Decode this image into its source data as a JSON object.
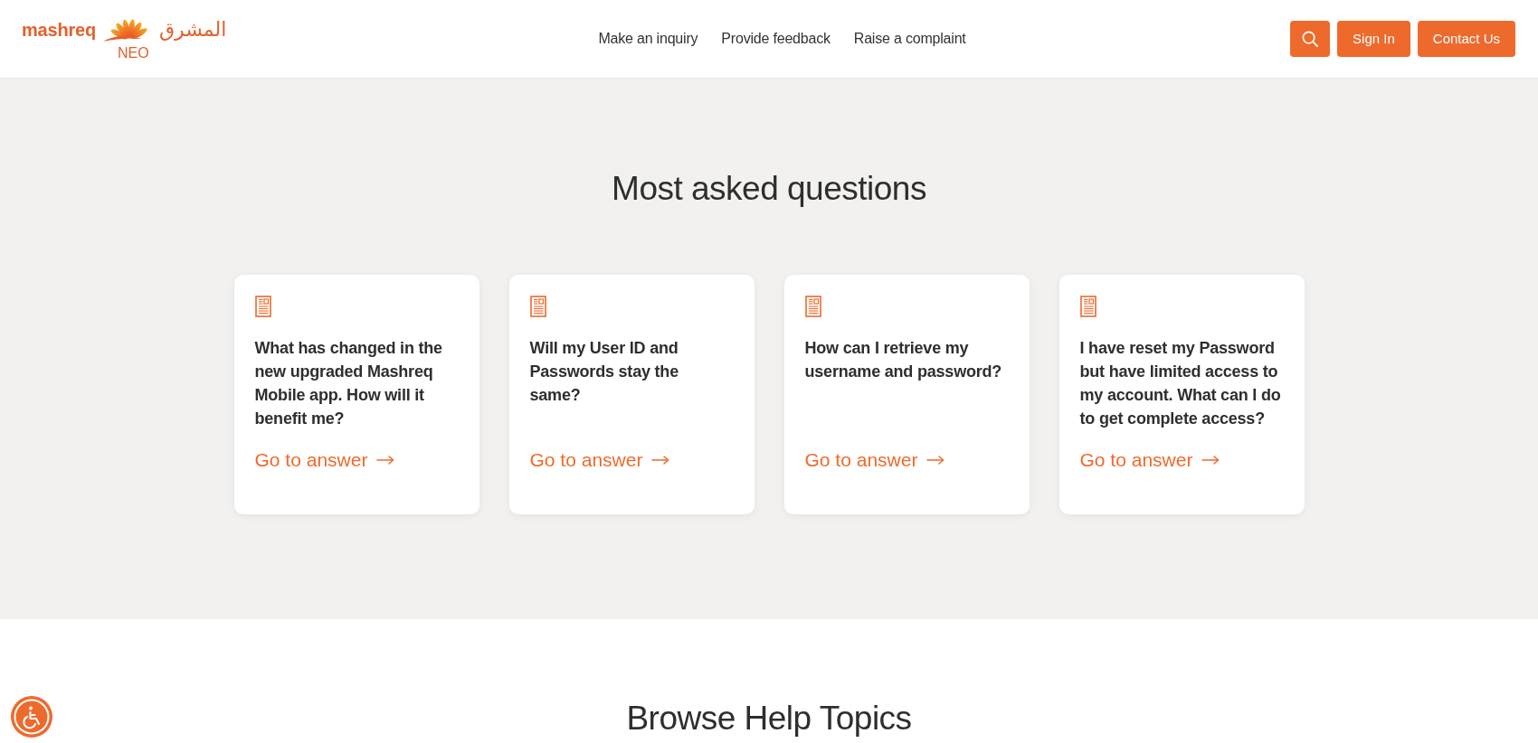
{
  "header": {
    "logo": {
      "wordmark": "mashreq",
      "arabic": "المشرق",
      "tagline": "NEO"
    },
    "nav": [
      {
        "label": "Make an inquiry"
      },
      {
        "label": "Provide feedback"
      },
      {
        "label": "Raise a complaint"
      }
    ],
    "actions": [
      {
        "kind": "search"
      },
      {
        "kind": "button",
        "label": "Sign In"
      },
      {
        "kind": "button",
        "label": "Contact Us"
      }
    ]
  },
  "most_asked": {
    "title": "Most asked questions",
    "cards": [
      {
        "question": "What has changed in the new upgraded Mashreq Mobile app. How will it benefit me?",
        "link": "Go to answer"
      },
      {
        "question": "Will my User ID and Passwords stay the same?",
        "link": "Go to answer"
      },
      {
        "question": "How can I retrieve my username and password?",
        "link": "Go to answer"
      },
      {
        "question": "I have reset my Password but have limited access to my account. What can I do to get complete access?",
        "link": "Go to answer"
      }
    ]
  },
  "help_topics": {
    "title": "Browse Help Topics"
  }
}
